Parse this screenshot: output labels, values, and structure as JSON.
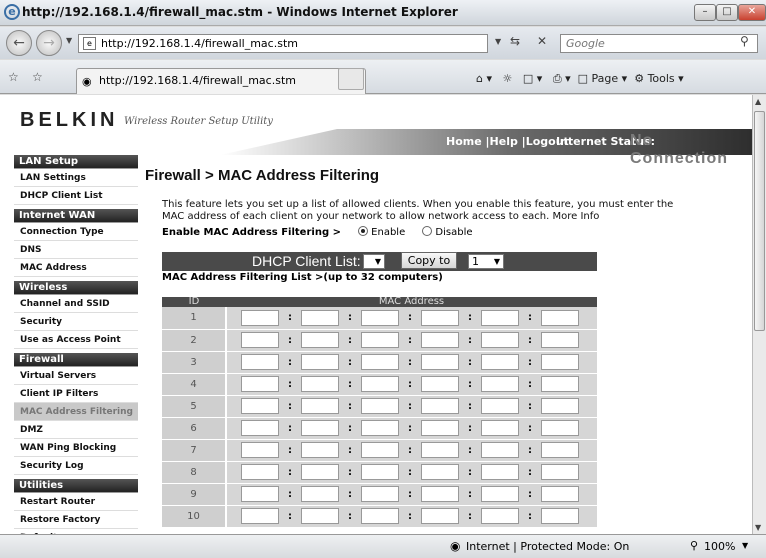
{
  "window": {
    "title": "http://192.168.1.4/firewall_mac.stm - Windows Internet Explorer"
  },
  "toolbar": {
    "address": "http://192.168.1.4/firewall_mac.stm",
    "search_placeholder": "Google"
  },
  "tab": {
    "label": "http://192.168.1.4/firewall_mac.stm"
  },
  "commands": {
    "page": "Page",
    "tools": "Tools"
  },
  "header": {
    "logo": "BELKIN",
    "tagline": "Wireless Router Setup Utility",
    "links": "Home |Help |Logout",
    "internet_status_label": "Internet Status:",
    "internet_status_value": "No Connection"
  },
  "sidebar": {
    "sections": [
      {
        "title": "LAN Setup",
        "items": [
          "LAN Settings",
          "DHCP Client List"
        ]
      },
      {
        "title": "Internet WAN",
        "items": [
          "Connection Type",
          "DNS",
          "MAC Address"
        ]
      },
      {
        "title": "Wireless",
        "items": [
          "Channel and SSID",
          "Security",
          "Use as Access Point"
        ]
      },
      {
        "title": "Firewall",
        "items": [
          "Virtual Servers",
          "Client IP Filters",
          "MAC Address Filtering",
          "DMZ",
          "WAN Ping Blocking",
          "Security Log"
        ]
      },
      {
        "title": "Utilities",
        "items": [
          "Restart Router",
          "Restore Factory Default"
        ]
      }
    ],
    "active": "MAC Address Filtering"
  },
  "page": {
    "title": "Firewall > MAC Address Filtering",
    "description": "This feature lets you set up a list of allowed clients. When you enable this feature, you must enter the MAC address of each client on your network to allow network access to each.",
    "more_info": "More Info",
    "enable_label": "Enable MAC Address Filtering >",
    "enable_option": "Enable",
    "disable_option": "Disable",
    "enabled": true,
    "dhcp_label": "DHCP Client List:",
    "copy_button": "Copy to",
    "copy_target": "1",
    "list_label": "MAC Address Filtering List >(up to 32 computers)",
    "table": {
      "col_id": "ID",
      "col_mac": "MAC Address",
      "rows": [
        "1",
        "2",
        "3",
        "4",
        "5",
        "6",
        "7",
        "8",
        "9",
        "10"
      ],
      "separator": ":"
    }
  },
  "status": {
    "zone": "Internet | Protected Mode: On",
    "zoom": "100%"
  }
}
